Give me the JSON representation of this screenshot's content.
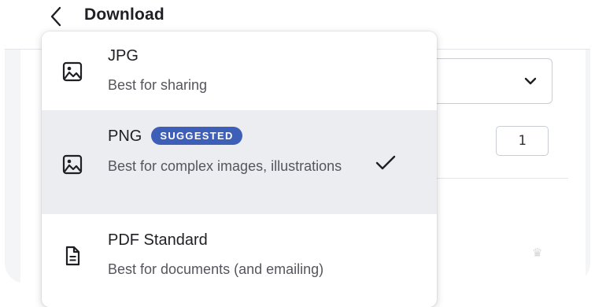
{
  "header": {
    "title": "Download"
  },
  "panel": {
    "quantity": "1"
  },
  "file_types": [
    {
      "title": "JPG",
      "description": "Best for sharing",
      "badge": "",
      "selected": false,
      "icon": "image-icon"
    },
    {
      "title": "PNG",
      "description": "Best for complex images, illustrations",
      "badge": "SUGGESTED",
      "selected": true,
      "icon": "image-icon"
    },
    {
      "title": "PDF Standard",
      "description": "Best for documents (and emailing)",
      "badge": "",
      "selected": false,
      "icon": "document-icon"
    }
  ],
  "colors": {
    "accent": "#3d5fb8",
    "selected_bg": "#ecedf1",
    "text": "#1f1f24",
    "muted": "#55565d"
  }
}
